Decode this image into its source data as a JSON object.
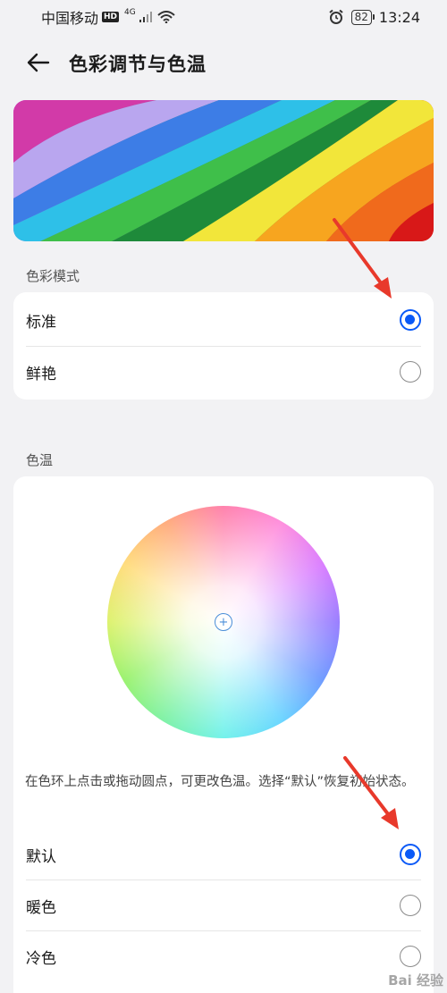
{
  "status_bar": {
    "carrier": "中国移动",
    "hd": "HD",
    "network": "4G",
    "battery": "82",
    "time": "13:24"
  },
  "header": {
    "title": "色彩调节与色温"
  },
  "color_mode": {
    "section_label": "色彩模式",
    "options": [
      {
        "label": "标准",
        "selected": true
      },
      {
        "label": "鲜艳",
        "selected": false
      }
    ]
  },
  "color_temp": {
    "section_label": "色温",
    "hint": "在色环上点击或拖动圆点，可更改色温。选择“默认”恢复初始状态。",
    "options": [
      {
        "label": "默认",
        "selected": true
      },
      {
        "label": "暖色",
        "selected": false
      },
      {
        "label": "冷色",
        "selected": false
      }
    ]
  },
  "watermark": {
    "text": "Bai 经验"
  },
  "colors": {
    "accent": "#0a59f7",
    "annotation_arrow": "#e8392b",
    "background": "#f2f2f4"
  }
}
